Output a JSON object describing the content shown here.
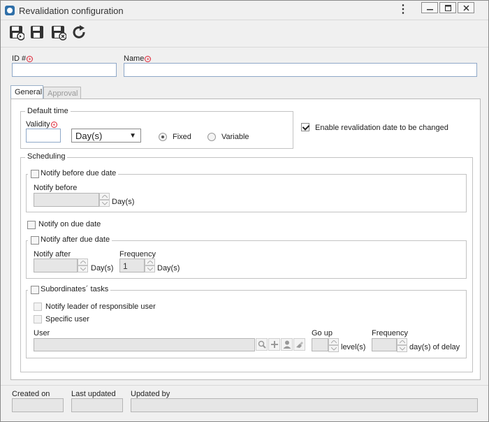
{
  "window": {
    "title": "Revalidation configuration"
  },
  "header": {
    "id_label": "ID #",
    "id_value": "",
    "name_label": "Name",
    "name_value": ""
  },
  "tabs": [
    {
      "label": "General",
      "active": true
    },
    {
      "label": "Approval",
      "active": false
    }
  ],
  "default_time": {
    "legend": "Default time",
    "validity_label": "Validity",
    "validity_value": "",
    "unit_value": "Day(s)",
    "fixed_label": "Fixed",
    "variable_label": "Variable",
    "selected": "Fixed"
  },
  "enable_change_label": "Enable revalidation date to be changed",
  "scheduling": {
    "legend": "Scheduling",
    "notify_before": {
      "checkbox_label": "Notify before due date",
      "field_label": "Notify before",
      "value": "",
      "unit": "Day(s)"
    },
    "notify_on_label": "Notify on due date",
    "notify_after": {
      "checkbox_label": "Notify after due date",
      "field_label": "Notify after",
      "value": "",
      "unit": "Day(s)",
      "frequency_label": "Frequency",
      "frequency_value": "1",
      "frequency_unit": "Day(s)"
    },
    "subordinates": {
      "checkbox_label": "Subordinates´ tasks",
      "notify_leader_label": "Notify leader of responsible user",
      "specific_user_label": "Specific user",
      "user_label": "User",
      "user_value": "",
      "go_up_label": "Go up",
      "go_up_value": "",
      "level_unit": "level(s)",
      "frequency_label": "Frequency",
      "frequency_value": "",
      "delay_unit": "day(s) of delay"
    }
  },
  "footer": {
    "created_on_label": "Created on",
    "created_on_value": "",
    "last_updated_label": "Last updated",
    "last_updated_value": "",
    "updated_by_label": "Updated by",
    "updated_by_value": ""
  },
  "icons": {
    "save_and_new": "save-and-new-icon",
    "save": "save-icon",
    "save_and_close": "save-and-close-icon",
    "refresh": "refresh-icon"
  },
  "colors": {
    "field_border": "#8fa8c8",
    "required_marker": "#dd2233",
    "disabled_field": "#e6e6e6"
  }
}
